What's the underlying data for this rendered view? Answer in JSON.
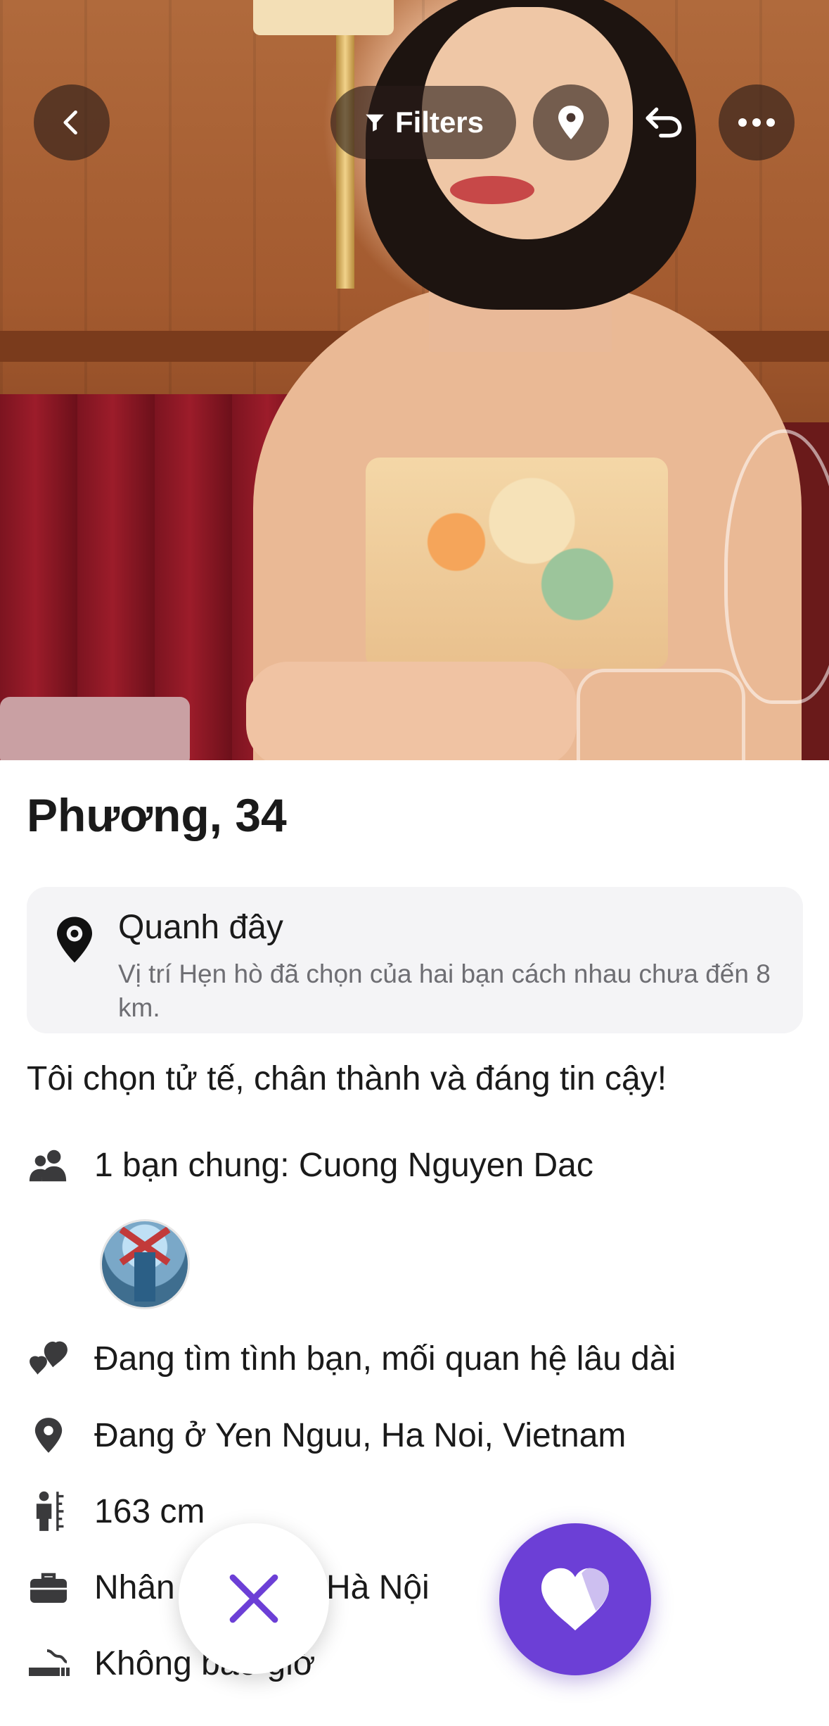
{
  "header": {
    "back_icon": "chevron-left-icon",
    "filters_label": "Filters",
    "filter_icon": "funnel-icon",
    "location_icon": "location-pin-icon",
    "undo_icon": "undo-icon",
    "more_icon": "more-horizontal-icon"
  },
  "profile": {
    "name_age": "Phương, 34",
    "location_card": {
      "title": "Quanh đây",
      "description": "Vị trí Hẹn hò đã chọn của hai bạn cách nhau chưa đến 8 km."
    },
    "bio": "Tôi chọn tử tế, chân thành và đáng tin cậy!",
    "details": {
      "mutual_friends": "1 bạn chung: Cuong Nguyen Dac",
      "looking_for": "Đang tìm tình bạn, mối quan hệ lâu dài",
      "lives_in": "Đang ở Yen Nguu, Ha Noi, Vietnam",
      "height": "163 cm",
      "job_start": "Nhân",
      "job_end": "Hà Nội",
      "smoking": "Không bao giờ"
    }
  },
  "actions": {
    "pass_icon": "close-icon",
    "like_icon": "heart-icon"
  },
  "colors": {
    "accent": "#6c3fd6",
    "text_primary": "#1a1a1a",
    "text_secondary": "#6e6e73",
    "card_bg": "#f4f4f6"
  }
}
